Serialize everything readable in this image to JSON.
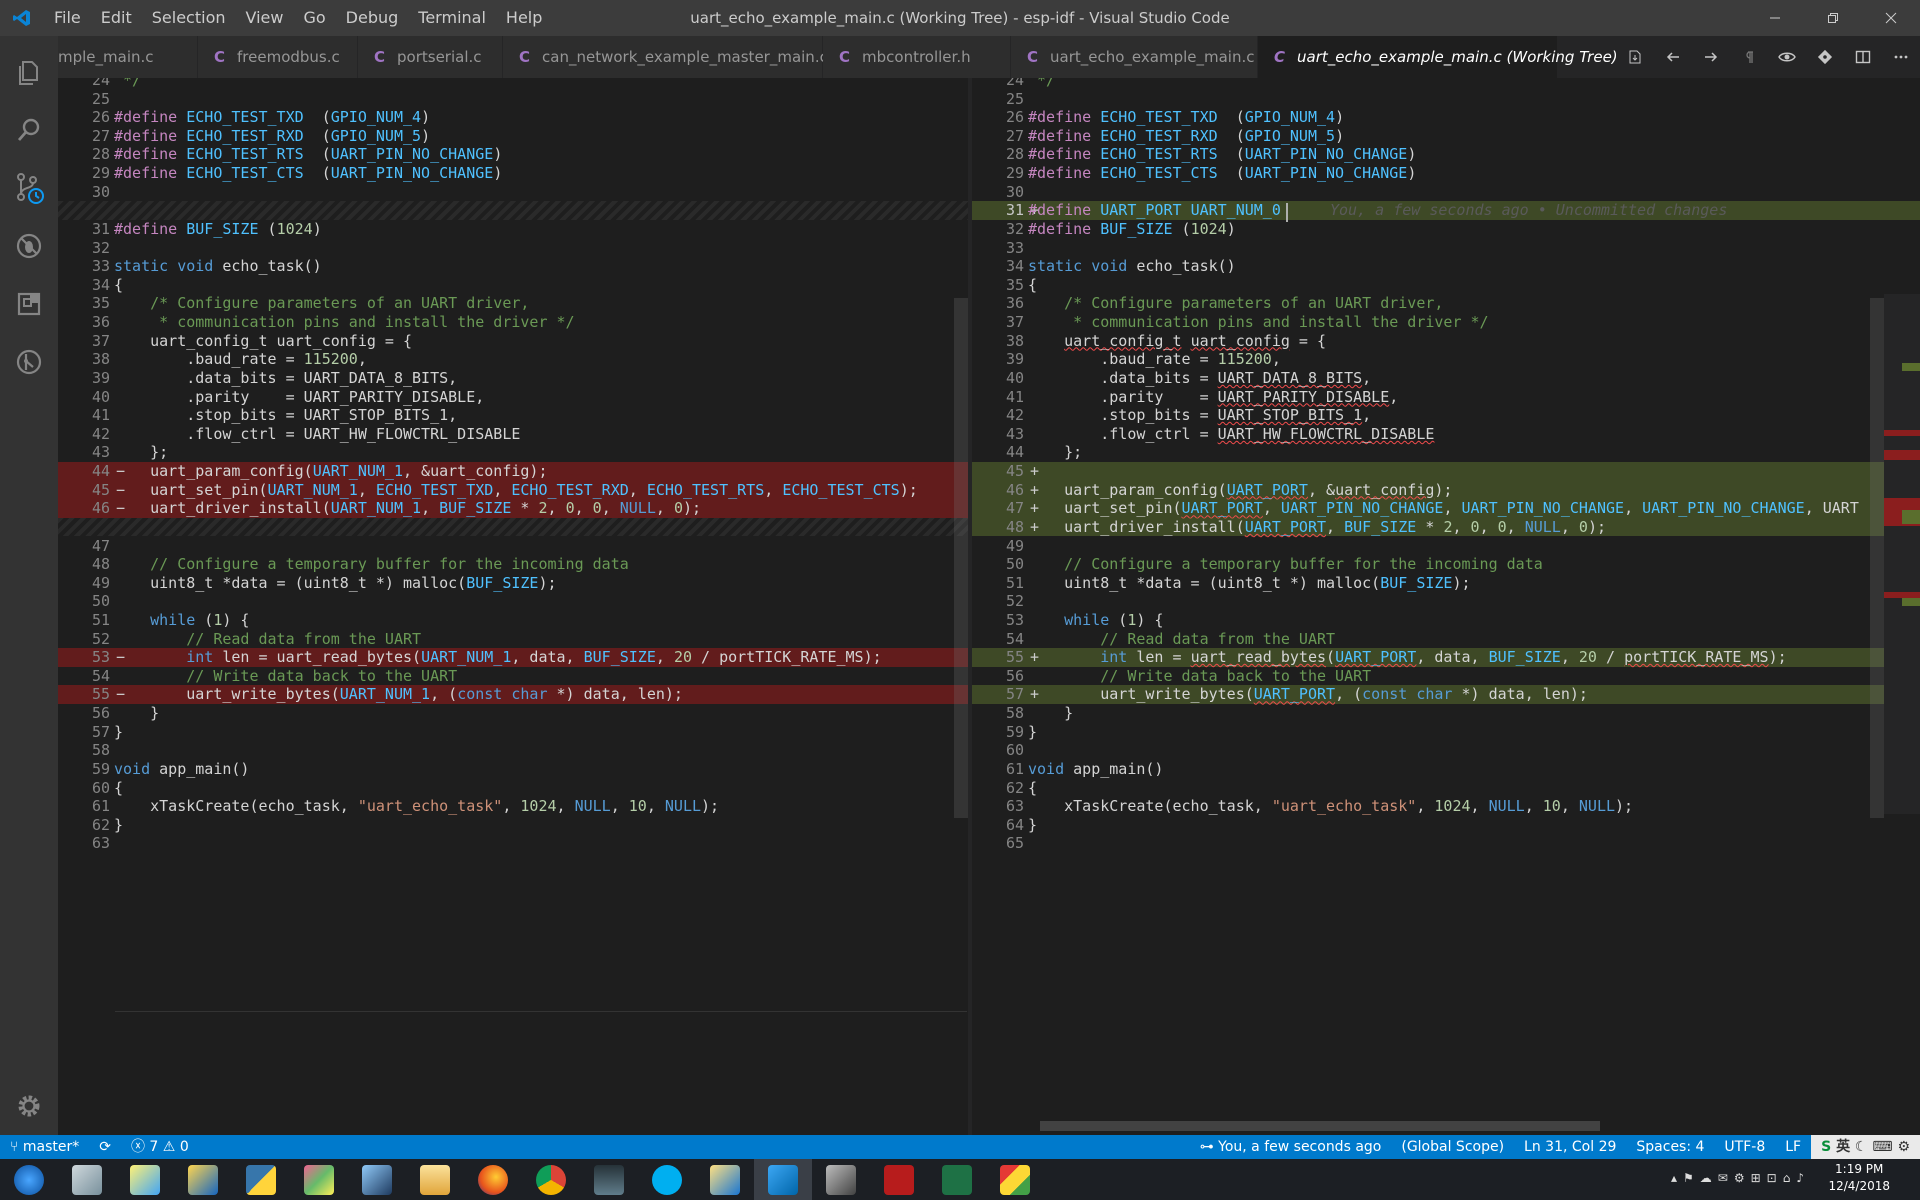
{
  "window": {
    "title": "uart_echo_example_main.c (Working Tree) - esp-idf - Visual Studio Code"
  },
  "menu": [
    "File",
    "Edit",
    "Selection",
    "View",
    "Go",
    "Debug",
    "Terminal",
    "Help"
  ],
  "tabs": [
    {
      "label": "mple_main.c",
      "active": false
    },
    {
      "label": "freemodbus.c",
      "active": false
    },
    {
      "label": "portserial.c",
      "active": false
    },
    {
      "label": "can_network_example_master_main.c",
      "active": false
    },
    {
      "label": "mbcontroller.h",
      "active": false
    },
    {
      "label": "uart_echo_example_main.c",
      "active": false
    },
    {
      "label": "uart_echo_example_main.c (Working Tree)",
      "active": true
    }
  ],
  "tab_icon_glyph": "C",
  "left_diff": [
    {
      "n": "24",
      "t": " */",
      "k": "ctx"
    },
    {
      "n": "25",
      "t": "",
      "k": "ctx"
    },
    {
      "n": "26",
      "t": "#define ECHO_TEST_TXD  (GPIO_NUM_4)",
      "k": "ctx"
    },
    {
      "n": "27",
      "t": "#define ECHO_TEST_RXD  (GPIO_NUM_5)",
      "k": "ctx"
    },
    {
      "n": "28",
      "t": "#define ECHO_TEST_RTS  (UART_PIN_NO_CHANGE)",
      "k": "ctx"
    },
    {
      "n": "29",
      "t": "#define ECHO_TEST_CTS  (UART_PIN_NO_CHANGE)",
      "k": "ctx"
    },
    {
      "n": "30",
      "t": "",
      "k": "ctx"
    },
    {
      "n": "",
      "t": "",
      "k": "gap"
    },
    {
      "n": "31",
      "t": "#define BUF_SIZE (1024)",
      "k": "ctx"
    },
    {
      "n": "32",
      "t": "",
      "k": "ctx"
    },
    {
      "n": "33",
      "t": "static void echo_task()",
      "k": "ctx"
    },
    {
      "n": "34",
      "t": "{",
      "k": "ctx"
    },
    {
      "n": "35",
      "t": "    /* Configure parameters of an UART driver,",
      "k": "ctx"
    },
    {
      "n": "36",
      "t": "     * communication pins and install the driver */",
      "k": "ctx"
    },
    {
      "n": "37",
      "t": "    uart_config_t uart_config = {",
      "k": "ctx"
    },
    {
      "n": "38",
      "t": "        .baud_rate = 115200,",
      "k": "ctx"
    },
    {
      "n": "39",
      "t": "        .data_bits = UART_DATA_8_BITS,",
      "k": "ctx"
    },
    {
      "n": "40",
      "t": "        .parity    = UART_PARITY_DISABLE,",
      "k": "ctx"
    },
    {
      "n": "41",
      "t": "        .stop_bits = UART_STOP_BITS_1,",
      "k": "ctx"
    },
    {
      "n": "42",
      "t": "        .flow_ctrl = UART_HW_FLOWCTRL_DISABLE",
      "k": "ctx"
    },
    {
      "n": "43",
      "t": "    };",
      "k": "ctx"
    },
    {
      "n": "44",
      "t": "    uart_param_config(UART_NUM_1, &uart_config);",
      "k": "del"
    },
    {
      "n": "45",
      "t": "    uart_set_pin(UART_NUM_1, ECHO_TEST_TXD, ECHO_TEST_RXD, ECHO_TEST_RTS, ECHO_TEST_CTS);",
      "k": "del"
    },
    {
      "n": "46",
      "t": "    uart_driver_install(UART_NUM_1, BUF_SIZE * 2, 0, 0, NULL, 0);",
      "k": "del"
    },
    {
      "n": "",
      "t": "",
      "k": "gap"
    },
    {
      "n": "47",
      "t": "",
      "k": "ctx"
    },
    {
      "n": "48",
      "t": "    // Configure a temporary buffer for the incoming data",
      "k": "ctx"
    },
    {
      "n": "49",
      "t": "    uint8_t *data = (uint8_t *) malloc(BUF_SIZE);",
      "k": "ctx"
    },
    {
      "n": "50",
      "t": "",
      "k": "ctx"
    },
    {
      "n": "51",
      "t": "    while (1) {",
      "k": "ctx"
    },
    {
      "n": "52",
      "t": "        // Read data from the UART",
      "k": "ctx"
    },
    {
      "n": "53",
      "t": "        int len = uart_read_bytes(UART_NUM_1, data, BUF_SIZE, 20 / portTICK_RATE_MS);",
      "k": "del"
    },
    {
      "n": "54",
      "t": "        // Write data back to the UART",
      "k": "ctx"
    },
    {
      "n": "55",
      "t": "        uart_write_bytes(UART_NUM_1, (const char *) data, len);",
      "k": "del"
    },
    {
      "n": "56",
      "t": "    }",
      "k": "ctx"
    },
    {
      "n": "57",
      "t": "}",
      "k": "ctx"
    },
    {
      "n": "58",
      "t": "",
      "k": "ctx"
    },
    {
      "n": "59",
      "t": "void app_main()",
      "k": "ctx"
    },
    {
      "n": "60",
      "t": "{",
      "k": "ctx"
    },
    {
      "n": "61",
      "t": "    xTaskCreate(echo_task, \"uart_echo_task\", 1024, NULL, 10, NULL);",
      "k": "ctx"
    },
    {
      "n": "62",
      "t": "}",
      "k": "ctx"
    },
    {
      "n": "63",
      "t": "",
      "k": "ctx"
    }
  ],
  "right_diff": [
    {
      "n": "24",
      "t": " */",
      "k": "ctx"
    },
    {
      "n": "25",
      "t": "",
      "k": "ctx"
    },
    {
      "n": "26",
      "t": "#define ECHO_TEST_TXD  (GPIO_NUM_4)",
      "k": "ctx"
    },
    {
      "n": "27",
      "t": "#define ECHO_TEST_RXD  (GPIO_NUM_5)",
      "k": "ctx"
    },
    {
      "n": "28",
      "t": "#define ECHO_TEST_RTS  (UART_PIN_NO_CHANGE)",
      "k": "ctx"
    },
    {
      "n": "29",
      "t": "#define ECHO_TEST_CTS  (UART_PIN_NO_CHANGE)",
      "k": "ctx"
    },
    {
      "n": "30",
      "t": "",
      "k": "ctx"
    },
    {
      "n": "31",
      "t": "#define UART_PORT UART_NUM_0",
      "k": "ins",
      "cur": true
    },
    {
      "n": "32",
      "t": "#define BUF_SIZE (1024)",
      "k": "ctx"
    },
    {
      "n": "33",
      "t": "",
      "k": "ctx"
    },
    {
      "n": "34",
      "t": "static void echo_task()",
      "k": "ctx"
    },
    {
      "n": "35",
      "t": "{",
      "k": "ctx"
    },
    {
      "n": "36",
      "t": "    /* Configure parameters of an UART driver,",
      "k": "ctx"
    },
    {
      "n": "37",
      "t": "     * communication pins and install the driver */",
      "k": "ctx"
    },
    {
      "n": "38",
      "t": "    uart_config_t uart_config = {",
      "k": "ctx"
    },
    {
      "n": "39",
      "t": "        .baud_rate = 115200,",
      "k": "ctx"
    },
    {
      "n": "40",
      "t": "        .data_bits = UART_DATA_8_BITS,",
      "k": "ctx"
    },
    {
      "n": "41",
      "t": "        .parity    = UART_PARITY_DISABLE,",
      "k": "ctx"
    },
    {
      "n": "42",
      "t": "        .stop_bits = UART_STOP_BITS_1,",
      "k": "ctx"
    },
    {
      "n": "43",
      "t": "        .flow_ctrl = UART_HW_FLOWCTRL_DISABLE",
      "k": "ctx"
    },
    {
      "n": "44",
      "t": "    };",
      "k": "ctx"
    },
    {
      "n": "45",
      "t": "",
      "k": "ins"
    },
    {
      "n": "46",
      "t": "    uart_param_config(UART_PORT, &uart_config);",
      "k": "ins"
    },
    {
      "n": "47",
      "t": "    uart_set_pin(UART_PORT, UART_PIN_NO_CHANGE, UART_PIN_NO_CHANGE, UART_PIN_NO_CHANGE, UART",
      "k": "ins"
    },
    {
      "n": "48",
      "t": "    uart_driver_install(UART_PORT, BUF_SIZE * 2, 0, 0, NULL, 0);",
      "k": "ins"
    },
    {
      "n": "49",
      "t": "",
      "k": "ctx"
    },
    {
      "n": "50",
      "t": "    // Configure a temporary buffer for the incoming data",
      "k": "ctx"
    },
    {
      "n": "51",
      "t": "    uint8_t *data = (uint8_t *) malloc(BUF_SIZE);",
      "k": "ctx"
    },
    {
      "n": "52",
      "t": "",
      "k": "ctx"
    },
    {
      "n": "53",
      "t": "    while (1) {",
      "k": "ctx"
    },
    {
      "n": "54",
      "t": "        // Read data from the UART",
      "k": "ctx"
    },
    {
      "n": "55",
      "t": "        int len = uart_read_bytes(UART_PORT, data, BUF_SIZE, 20 / portTICK_RATE_MS);",
      "k": "ins"
    },
    {
      "n": "56",
      "t": "        // Write data back to the UART",
      "k": "ctx"
    },
    {
      "n": "57",
      "t": "        uart_write_bytes(UART_PORT, (const char *) data, len);",
      "k": "ins"
    },
    {
      "n": "58",
      "t": "    }",
      "k": "ctx"
    },
    {
      "n": "59",
      "t": "}",
      "k": "ctx"
    },
    {
      "n": "60",
      "t": "",
      "k": "ctx"
    },
    {
      "n": "61",
      "t": "void app_main()",
      "k": "ctx"
    },
    {
      "n": "62",
      "t": "{",
      "k": "ctx"
    },
    {
      "n": "63",
      "t": "    xTaskCreate(echo_task, \"uart_echo_task\", 1024, NULL, 10, NULL);",
      "k": "ctx"
    },
    {
      "n": "64",
      "t": "}",
      "k": "ctx"
    },
    {
      "n": "65",
      "t": "",
      "k": "ctx"
    }
  ],
  "inline_blame": "You, a few seconds ago • Uncommitted changes",
  "diff_marks": {
    "del": "−",
    "ins": "+"
  },
  "status": {
    "branch": "master*",
    "errors": "7",
    "warnings": "0",
    "blame": "You, a few seconds ago",
    "scope": "(Global Scope)",
    "position": "Ln 31, Col 29",
    "spaces": "Spaces: 4",
    "encoding": "UTF-8",
    "eol": "LF",
    "ime": "英"
  },
  "clock": {
    "time": "1:19 PM",
    "date": "12/4/2018"
  },
  "colors": {
    "accent": "#007acc",
    "deleted": "#9b1c1c",
    "inserted": "#5a6e2d"
  }
}
